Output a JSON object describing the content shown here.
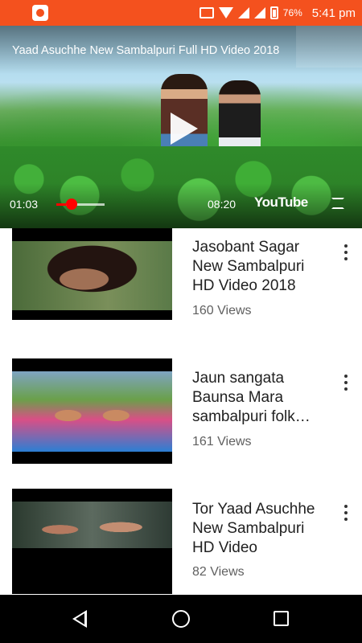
{
  "status_bar": {
    "battery": "76%",
    "time": "5:41 pm",
    "icons": [
      "app-icon",
      "cast-icon",
      "wifi-icon",
      "signal-icon",
      "battery-icon"
    ]
  },
  "player": {
    "title": "Yaad Asuchhe New Sambalpuri Full HD Video 2018",
    "current_time": "01:03",
    "duration": "08:20",
    "progress_fraction": 0.126,
    "logo_text": "YouTube"
  },
  "videos": [
    {
      "title": "Jasobant Sagar New Sambalpuri HD Video 2018",
      "views": "160 Views"
    },
    {
      "title": "Jaun sangata Baunsa Mara sambalpuri folk…",
      "views": "161 Views"
    },
    {
      "title": "Tor Yaad Asuchhe New Sambalpuri HD Video",
      "views": "82 Views"
    }
  ],
  "nav_bar": {
    "icons": [
      "back-icon",
      "home-icon",
      "recent-apps-icon"
    ]
  },
  "colors": {
    "status_bar": "#f4511e",
    "progress": "#ff0000",
    "nav_bar": "#000000"
  }
}
